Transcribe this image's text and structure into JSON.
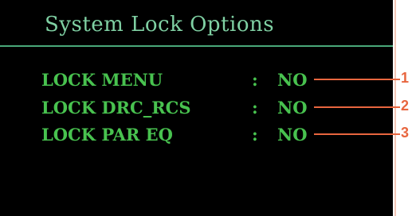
{
  "window": {
    "title": "System Lock Options"
  },
  "options": [
    {
      "label": "LOCK MENU",
      "separator": ":",
      "value": "NO",
      "callout": "1"
    },
    {
      "label": "LOCK DRC_RCS",
      "separator": ":",
      "value": "NO",
      "callout": "2"
    },
    {
      "label": "LOCK PAR EQ",
      "separator": ":",
      "value": "NO",
      "callout": "3"
    }
  ],
  "colors": {
    "screen_bg": "#000000",
    "title_text": "#7fd0a3",
    "rule": "#4aa879",
    "option_text": "#48c24f",
    "callout": "#e8663f"
  }
}
